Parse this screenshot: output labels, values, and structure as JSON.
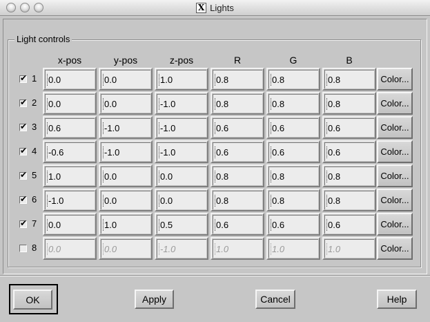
{
  "window": {
    "title": "Lights",
    "title_icon": "X"
  },
  "group": {
    "title": "Light controls"
  },
  "columns": [
    "x-pos",
    "y-pos",
    "z-pos",
    "R",
    "G",
    "B"
  ],
  "rows": [
    {
      "num": "1",
      "checked": true,
      "values": [
        "0.0",
        "0.0",
        "1.0",
        "0.8",
        "0.8",
        "0.8"
      ]
    },
    {
      "num": "2",
      "checked": true,
      "values": [
        "0.0",
        "0.0",
        "-1.0",
        "0.8",
        "0.8",
        "0.8"
      ]
    },
    {
      "num": "3",
      "checked": true,
      "values": [
        "0.6",
        "-1.0",
        "-1.0",
        "0.6",
        "0.6",
        "0.6"
      ]
    },
    {
      "num": "4",
      "checked": true,
      "values": [
        "-0.6",
        "-1.0",
        "-1.0",
        "0.6",
        "0.6",
        "0.6"
      ]
    },
    {
      "num": "5",
      "checked": true,
      "values": [
        "1.0",
        "0.0",
        "0.0",
        "0.8",
        "0.8",
        "0.8"
      ]
    },
    {
      "num": "6",
      "checked": true,
      "values": [
        "-1.0",
        "0.0",
        "0.0",
        "0.8",
        "0.8",
        "0.8"
      ]
    },
    {
      "num": "7",
      "checked": true,
      "values": [
        "0.0",
        "1.0",
        "0.5",
        "0.6",
        "0.6",
        "0.6"
      ]
    },
    {
      "num": "8",
      "checked": false,
      "values": [
        "0.0",
        "0.0",
        "-1.0",
        "1.0",
        "1.0",
        "1.0"
      ]
    }
  ],
  "color_button_label": "Color...",
  "buttons": {
    "ok": "OK",
    "apply": "Apply",
    "cancel": "Cancel",
    "help": "Help"
  },
  "theme": {
    "background": "#c6c6c6",
    "field_bg": "#ececec",
    "disabled_text": "#9a9a9a"
  }
}
